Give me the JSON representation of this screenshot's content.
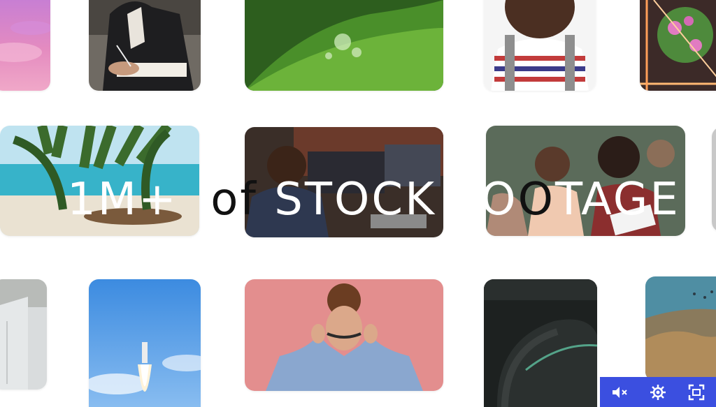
{
  "headline": {
    "part1": "1M+",
    "part2": "of",
    "part3": "STOCK",
    "part4": "FO",
    "part5": "O",
    "part6": "TAGE"
  },
  "tiles": [
    {
      "name": "pink-sky-clip"
    },
    {
      "name": "person-writing-clip"
    },
    {
      "name": "green-leaf-water-clip"
    },
    {
      "name": "smiling-woman-clip"
    },
    {
      "name": "neon-flower-clip"
    },
    {
      "name": "beach-palm-clip"
    },
    {
      "name": "man-at-computer-clip"
    },
    {
      "name": "office-team-clip"
    },
    {
      "name": "edge-clip"
    },
    {
      "name": "white-wall-clip"
    },
    {
      "name": "rocket-launch-clip"
    },
    {
      "name": "man-mustache-pink-clip"
    },
    {
      "name": "dark-machine-clip"
    },
    {
      "name": "underwater-reef-clip"
    }
  ],
  "controls": {
    "icons": [
      "mute-icon",
      "gear-icon",
      "fullscreen-icon"
    ],
    "background": "#3b4fe0"
  }
}
